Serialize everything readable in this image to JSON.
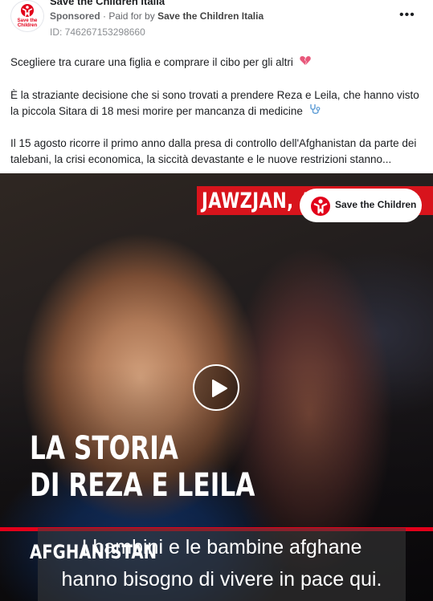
{
  "header": {
    "page_name": "Save the Children Italia",
    "sponsored": "Sponsored",
    "paid_prefix": "Paid for by",
    "payer": "Save the Children Italia",
    "ad_id": "ID: 746267153298660",
    "avatar_text_1": "Save the",
    "avatar_text_2": "Children",
    "more_icon": "•••"
  },
  "body": {
    "line1": "Scegliere tra curare una figlia e comprare il cibo per gli altri",
    "line2": "È la straziante decisione che si sono trovati a prendere Reza e Leila, che hanno visto la piccola Sitara di 18 mesi morire per mancanza di medicine",
    "line3": "Il 15 agosto ricorre il primo anno dalla presa di controllo dell'Afghanistan da parte dei talebani, la crisi economica, la siccità devastante e le nuove restrizioni stanno..."
  },
  "video": {
    "location": "JAWZJAN, A",
    "logo_text": "Save the Children",
    "title_line1": "LA STORIA",
    "title_line2": "DI REZA E LEILA",
    "country": "AFGHANISTAN",
    "subtitle_line1": "I bambini e le bambine afghane",
    "subtitle_line2": "hanno bisogno di vivere in pace qui."
  },
  "colors": {
    "brand_red": "#e2001a",
    "emoji_heart": "#e8577a",
    "stethoscope": "#5b9bd5"
  },
  "icons": [
    "broken-heart-icon",
    "stethoscope-icon",
    "play-icon",
    "more-icon",
    "save-the-children-logo-icon"
  ]
}
